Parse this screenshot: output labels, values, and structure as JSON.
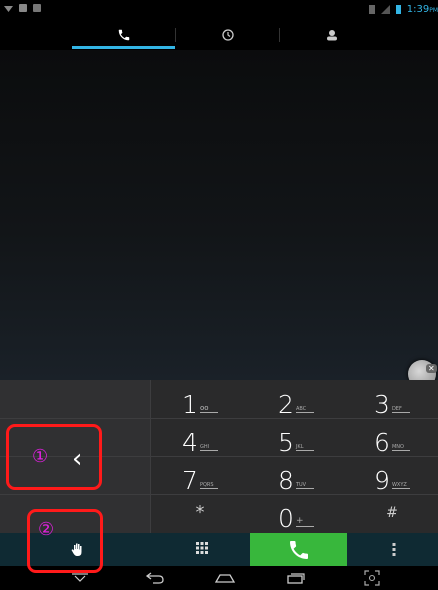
{
  "status_bar": {
    "time": "1:39",
    "time_suffix": "PM",
    "left_icons": [
      "wifi-icon",
      "image-icon",
      "notification-icon"
    ],
    "right_icons": [
      "sim-icon",
      "signal-icon",
      "battery-icon"
    ]
  },
  "tabs": [
    {
      "icon": "phone-icon",
      "selected": true
    },
    {
      "icon": "clock-icon",
      "selected": false
    },
    {
      "icon": "contacts-icon",
      "selected": false
    }
  ],
  "dialpad": {
    "keys": [
      {
        "digit": "1",
        "letters": "",
        "voicemail": true
      },
      {
        "digit": "2",
        "letters": "ABC"
      },
      {
        "digit": "3",
        "letters": "DEF"
      },
      {
        "digit": "4",
        "letters": "GHI"
      },
      {
        "digit": "5",
        "letters": "JKL"
      },
      {
        "digit": "6",
        "letters": "MNO"
      },
      {
        "digit": "7",
        "letters": "PQRS"
      },
      {
        "digit": "8",
        "letters": "TUV"
      },
      {
        "digit": "9",
        "letters": "WXYZ"
      },
      {
        "digit": "*",
        "letters": ""
      },
      {
        "digit": "0",
        "letters": "+"
      },
      {
        "digit": "#",
        "letters": ""
      }
    ]
  },
  "annotations": {
    "one": "①",
    "two": "②"
  },
  "back_glyph": "‹",
  "colors": {
    "accent": "#33b5e5",
    "call_green": "#38b73c",
    "annotation_red": "#ff1a1a",
    "annotation_magenta": "#e020e0"
  }
}
